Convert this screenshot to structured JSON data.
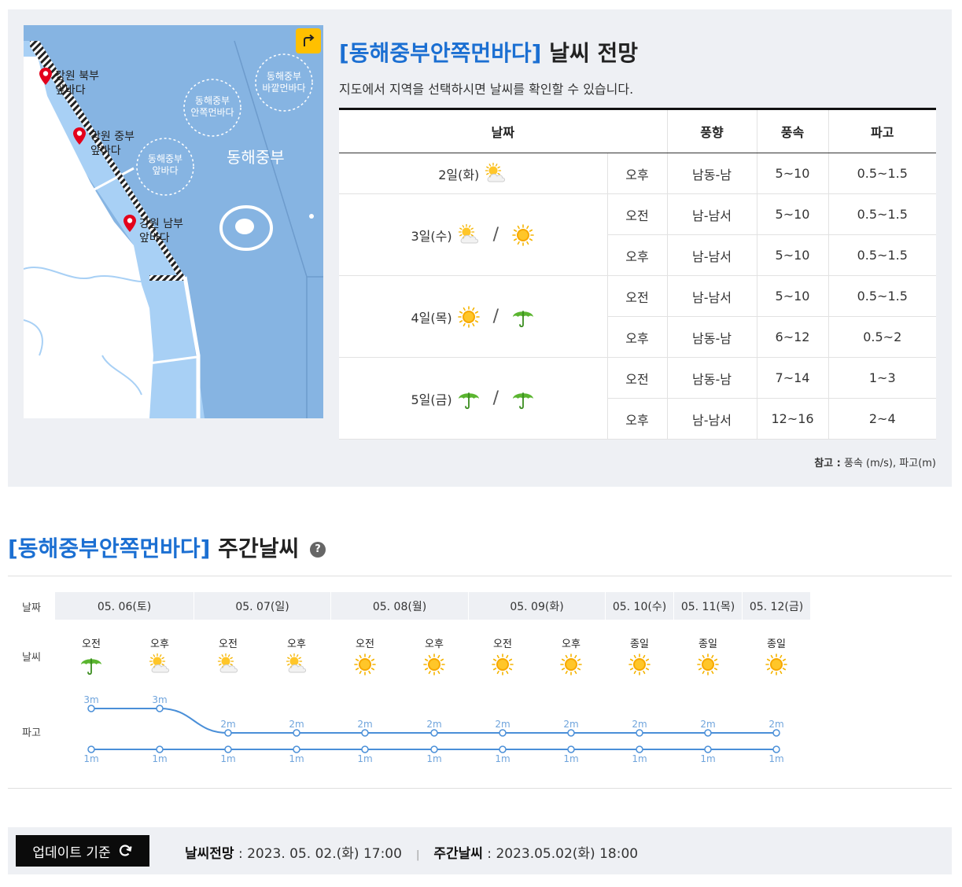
{
  "map": {
    "share_icon": "share-arrow-icon",
    "pins": [
      {
        "line1": "강원 북부",
        "line2": "앞바다"
      },
      {
        "line1": "강원 중부",
        "line2": "앞바다"
      },
      {
        "line1": "강원 남부",
        "line2": "앞바다"
      }
    ],
    "zones": [
      {
        "line1": "동해중부",
        "line2": "바깥먼바다"
      },
      {
        "line1": "동해중부",
        "line2": "안쪽먼바다"
      },
      {
        "line1": "동해중부",
        "line2": "앞바다"
      }
    ],
    "region_big": "동해중부",
    "colors": {
      "sea": "#86b4e2",
      "coast_sea": "#a8d0f5",
      "land": "#ffffff"
    }
  },
  "forecast": {
    "title_region": "[동해중부안쪽먼바다]",
    "title_suffix": " 날씨 전망",
    "description": "지도에서 지역을 선택하시면 날씨를 확인할 수 있습니다.",
    "headers": {
      "date": "날짜",
      "wind_dir": "풍향",
      "wind_speed": "풍속",
      "wave": "파고"
    },
    "days": [
      {
        "date": "2일(화)",
        "icons": [
          "partly-cloudy-icon"
        ],
        "rows": [
          {
            "period": "오후",
            "dir": "남동-남",
            "speed": "5~10",
            "wave": "0.5~1.5"
          }
        ]
      },
      {
        "date": "3일(수)",
        "icons": [
          "partly-cloudy-icon",
          "sunny-icon"
        ],
        "rows": [
          {
            "period": "오전",
            "dir": "남-남서",
            "speed": "5~10",
            "wave": "0.5~1.5"
          },
          {
            "period": "오후",
            "dir": "남-남서",
            "speed": "5~10",
            "wave": "0.5~1.5"
          }
        ]
      },
      {
        "date": "4일(목)",
        "icons": [
          "sunny-icon",
          "umbrella-icon"
        ],
        "rows": [
          {
            "period": "오전",
            "dir": "남-남서",
            "speed": "5~10",
            "wave": "0.5~1.5"
          },
          {
            "period": "오후",
            "dir": "남동-남",
            "speed": "6~12",
            "wave": "0.5~2"
          }
        ]
      },
      {
        "date": "5일(금)",
        "icons": [
          "umbrella-icon",
          "umbrella-icon"
        ],
        "rows": [
          {
            "period": "오전",
            "dir": "남동-남",
            "speed": "7~14",
            "wave": "1~3"
          },
          {
            "period": "오후",
            "dir": "남-남서",
            "speed": "12~16",
            "wave": "2~4"
          }
        ]
      }
    ],
    "note_label": "참고 :",
    "note_text": " 풍속 (m/s), 파고(m)"
  },
  "weekly": {
    "title_region": "[동해중부안쪽먼바다]",
    "title_suffix": " 주간날씨",
    "help_icon": "?",
    "row_labels": {
      "date": "날짜",
      "weather": "날씨",
      "wave": "파고"
    },
    "dates": [
      "05. 06(토)",
      "05. 07(일)",
      "05. 08(월)",
      "05. 09(화)",
      "05. 10(수)",
      "05. 11(목)",
      "05. 12(금)"
    ],
    "periods": [
      "오전",
      "오후",
      "오전",
      "오후",
      "오전",
      "오후",
      "오전",
      "오후",
      "종일",
      "종일",
      "종일"
    ],
    "icons": [
      "umbrella-icon",
      "partly-cloudy-icon",
      "partly-cloudy-icon",
      "partly-cloudy-icon",
      "sunny-icon",
      "sunny-icon",
      "sunny-icon",
      "sunny-icon",
      "sunny-icon",
      "sunny-icon",
      "sunny-icon"
    ],
    "wave_max": [
      3,
      3,
      2,
      2,
      2,
      2,
      2,
      2,
      2,
      2,
      2
    ],
    "wave_min": [
      1,
      1,
      1,
      1,
      1,
      1,
      1,
      1,
      1,
      1,
      1
    ],
    "wave_unit": "m",
    "line_color": "#4a8fd8",
    "label_color": "#6fa4dc"
  },
  "footer": {
    "update_button": "업데이트 기준",
    "refresh_icon": "refresh-icon",
    "forecast_label": "날씨전망",
    "forecast_time": " : 2023. 05. 02.(화) 17:00",
    "separator": "|",
    "weekly_label": "주간날씨",
    "weekly_time": " : 2023.05.02(화) 18:00"
  }
}
